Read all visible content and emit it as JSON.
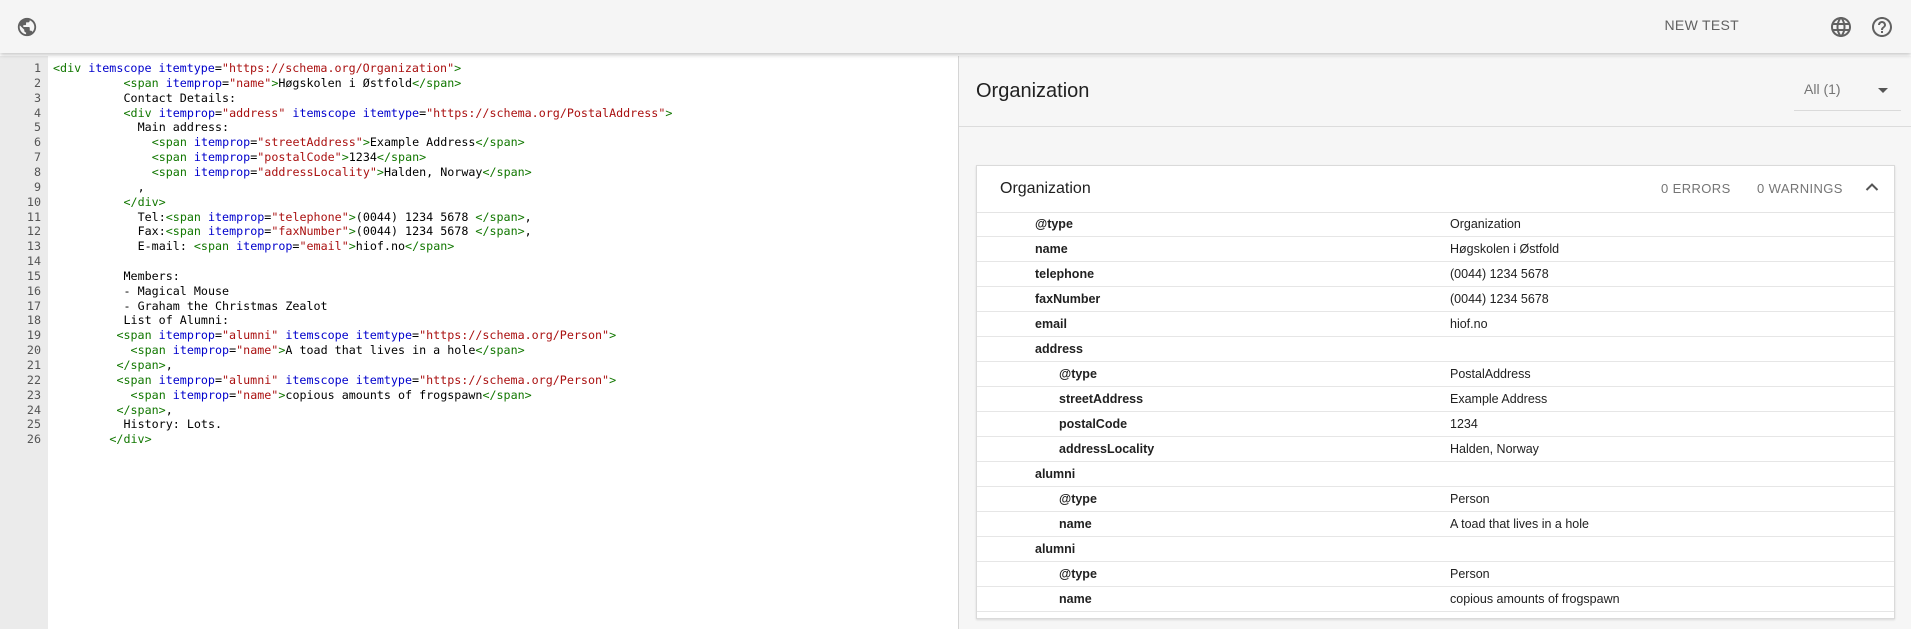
{
  "topbar": {
    "logo_icon": "globe-logo-icon",
    "new_test_label": "NEW TEST",
    "language_icon": "language-icon",
    "help_icon": "help-icon"
  },
  "editor": {
    "lines": [
      {
        "n": "1",
        "indent": 0,
        "parts": [
          [
            "tag",
            "<div "
          ],
          [
            "attr",
            "itemscope itemtype"
          ],
          [
            "txt",
            "="
          ],
          [
            "str",
            "\"https://schema.org/Organization\""
          ],
          [
            "tag",
            ">"
          ]
        ]
      },
      {
        "n": "2",
        "indent": 10,
        "parts": [
          [
            "tag",
            "<span "
          ],
          [
            "attr",
            "itemprop"
          ],
          [
            "txt",
            "="
          ],
          [
            "str",
            "\"name\""
          ],
          [
            "tag",
            ">"
          ],
          [
            "txt",
            "Høgskolen i Østfold"
          ],
          [
            "tag",
            "</span>"
          ]
        ]
      },
      {
        "n": "3",
        "indent": 10,
        "parts": [
          [
            "txt",
            "Contact Details:"
          ]
        ]
      },
      {
        "n": "4",
        "indent": 10,
        "parts": [
          [
            "tag",
            "<div "
          ],
          [
            "attr",
            "itemprop"
          ],
          [
            "txt",
            "="
          ],
          [
            "str",
            "\"address\""
          ],
          [
            "attr",
            " itemscope itemtype"
          ],
          [
            "txt",
            "="
          ],
          [
            "str",
            "\"https://schema.org/PostalAddress\""
          ],
          [
            "tag",
            ">"
          ]
        ]
      },
      {
        "n": "5",
        "indent": 12,
        "parts": [
          [
            "txt",
            "Main address:"
          ]
        ]
      },
      {
        "n": "6",
        "indent": 14,
        "parts": [
          [
            "tag",
            "<span "
          ],
          [
            "attr",
            "itemprop"
          ],
          [
            "txt",
            "="
          ],
          [
            "str",
            "\"streetAddress\""
          ],
          [
            "tag",
            ">"
          ],
          [
            "txt",
            "Example Address"
          ],
          [
            "tag",
            "</span>"
          ]
        ]
      },
      {
        "n": "7",
        "indent": 14,
        "parts": [
          [
            "tag",
            "<span "
          ],
          [
            "attr",
            "itemprop"
          ],
          [
            "txt",
            "="
          ],
          [
            "str",
            "\"postalCode\""
          ],
          [
            "tag",
            ">"
          ],
          [
            "txt",
            "1234"
          ],
          [
            "tag",
            "</span>"
          ]
        ]
      },
      {
        "n": "8",
        "indent": 14,
        "parts": [
          [
            "tag",
            "<span "
          ],
          [
            "attr",
            "itemprop"
          ],
          [
            "txt",
            "="
          ],
          [
            "str",
            "\"addressLocality\""
          ],
          [
            "tag",
            ">"
          ],
          [
            "txt",
            "Halden, Norway"
          ],
          [
            "tag",
            "</span>"
          ]
        ]
      },
      {
        "n": "9",
        "indent": 12,
        "parts": [
          [
            "txt",
            ","
          ]
        ]
      },
      {
        "n": "10",
        "indent": 10,
        "parts": [
          [
            "tag",
            "</div>"
          ]
        ]
      },
      {
        "n": "11",
        "indent": 12,
        "parts": [
          [
            "txt",
            "Tel:"
          ],
          [
            "tag",
            "<span "
          ],
          [
            "attr",
            "itemprop"
          ],
          [
            "txt",
            "="
          ],
          [
            "str",
            "\"telephone\""
          ],
          [
            "tag",
            ">"
          ],
          [
            "txt",
            "(0044) 1234 5678 "
          ],
          [
            "tag",
            "</span>"
          ],
          [
            "txt",
            ","
          ]
        ]
      },
      {
        "n": "12",
        "indent": 12,
        "parts": [
          [
            "txt",
            "Fax:"
          ],
          [
            "tag",
            "<span "
          ],
          [
            "attr",
            "itemprop"
          ],
          [
            "txt",
            "="
          ],
          [
            "str",
            "\"faxNumber\""
          ],
          [
            "tag",
            ">"
          ],
          [
            "txt",
            "(0044) 1234 5678 "
          ],
          [
            "tag",
            "</span>"
          ],
          [
            "txt",
            ","
          ]
        ]
      },
      {
        "n": "13",
        "indent": 12,
        "parts": [
          [
            "txt",
            "E-mail: "
          ],
          [
            "tag",
            "<span "
          ],
          [
            "attr",
            "itemprop"
          ],
          [
            "txt",
            "="
          ],
          [
            "str",
            "\"email\""
          ],
          [
            "tag",
            ">"
          ],
          [
            "txt",
            "hiof.no"
          ],
          [
            "tag",
            "</span>"
          ]
        ]
      },
      {
        "n": "14",
        "indent": 0,
        "parts": []
      },
      {
        "n": "15",
        "indent": 10,
        "parts": [
          [
            "txt",
            "Members:"
          ]
        ]
      },
      {
        "n": "16",
        "indent": 10,
        "parts": [
          [
            "txt",
            "- Magical Mouse"
          ]
        ]
      },
      {
        "n": "17",
        "indent": 10,
        "parts": [
          [
            "txt",
            "- Graham the Christmas Zealot"
          ]
        ]
      },
      {
        "n": "18",
        "indent": 10,
        "parts": [
          [
            "txt",
            "List of Alumni:"
          ]
        ]
      },
      {
        "n": "19",
        "indent": 9,
        "parts": [
          [
            "tag",
            "<span "
          ],
          [
            "attr",
            "itemprop"
          ],
          [
            "txt",
            "="
          ],
          [
            "str",
            "\"alumni\""
          ],
          [
            "attr",
            " itemscope itemtype"
          ],
          [
            "txt",
            "="
          ],
          [
            "str",
            "\"https://schema.org/Person\""
          ],
          [
            "tag",
            ">"
          ]
        ]
      },
      {
        "n": "20",
        "indent": 11,
        "parts": [
          [
            "tag",
            "<span "
          ],
          [
            "attr",
            "itemprop"
          ],
          [
            "txt",
            "="
          ],
          [
            "str",
            "\"name\""
          ],
          [
            "tag",
            ">"
          ],
          [
            "txt",
            "A toad that lives in a hole"
          ],
          [
            "tag",
            "</span>"
          ]
        ]
      },
      {
        "n": "21",
        "indent": 9,
        "parts": [
          [
            "tag",
            "</span>"
          ],
          [
            "txt",
            ","
          ]
        ]
      },
      {
        "n": "22",
        "indent": 9,
        "parts": [
          [
            "tag",
            "<span "
          ],
          [
            "attr",
            "itemprop"
          ],
          [
            "txt",
            "="
          ],
          [
            "str",
            "\"alumni\""
          ],
          [
            "attr",
            " itemscope itemtype"
          ],
          [
            "txt",
            "="
          ],
          [
            "str",
            "\"https://schema.org/Person\""
          ],
          [
            "tag",
            ">"
          ]
        ]
      },
      {
        "n": "23",
        "indent": 11,
        "parts": [
          [
            "tag",
            "<span "
          ],
          [
            "attr",
            "itemprop"
          ],
          [
            "txt",
            "="
          ],
          [
            "str",
            "\"name\""
          ],
          [
            "tag",
            ">"
          ],
          [
            "txt",
            "copious amounts of frogspawn"
          ],
          [
            "tag",
            "</span>"
          ]
        ]
      },
      {
        "n": "24",
        "indent": 9,
        "parts": [
          [
            "tag",
            "</span>"
          ],
          [
            "txt",
            ","
          ]
        ]
      },
      {
        "n": "25",
        "indent": 10,
        "parts": [
          [
            "txt",
            "History: Lots."
          ]
        ]
      },
      {
        "n": "26",
        "indent": 8,
        "parts": [
          [
            "tag",
            "</div>"
          ]
        ]
      }
    ]
  },
  "results": {
    "title": "Organization",
    "filter_label": "All (1)",
    "card": {
      "title": "Organization",
      "errors": "0 ERRORS",
      "warnings": "0 WARNINGS",
      "rows": [
        {
          "key": "@type",
          "value": "Organization",
          "level": 1
        },
        {
          "key": "name",
          "value": "Høgskolen i Østfold",
          "level": 1
        },
        {
          "key": "telephone",
          "value": "(0044) 1234 5678",
          "level": 1
        },
        {
          "key": "faxNumber",
          "value": "(0044) 1234 5678",
          "level": 1
        },
        {
          "key": "email",
          "value": "hiof.no",
          "level": 1
        },
        {
          "key": "address",
          "value": "",
          "level": 1
        },
        {
          "key": "@type",
          "value": "PostalAddress",
          "level": 2
        },
        {
          "key": "streetAddress",
          "value": "Example Address",
          "level": 2
        },
        {
          "key": "postalCode",
          "value": "1234",
          "level": 2
        },
        {
          "key": "addressLocality",
          "value": "Halden, Norway",
          "level": 2
        },
        {
          "key": "alumni",
          "value": "",
          "level": 1
        },
        {
          "key": "@type",
          "value": "Person",
          "level": 2
        },
        {
          "key": "name",
          "value": "A toad that lives in a hole",
          "level": 2
        },
        {
          "key": "alumni",
          "value": "",
          "level": 1
        },
        {
          "key": "@type",
          "value": "Person",
          "level": 2
        },
        {
          "key": "name",
          "value": "copious amounts of frogspawn",
          "level": 2
        }
      ]
    }
  }
}
